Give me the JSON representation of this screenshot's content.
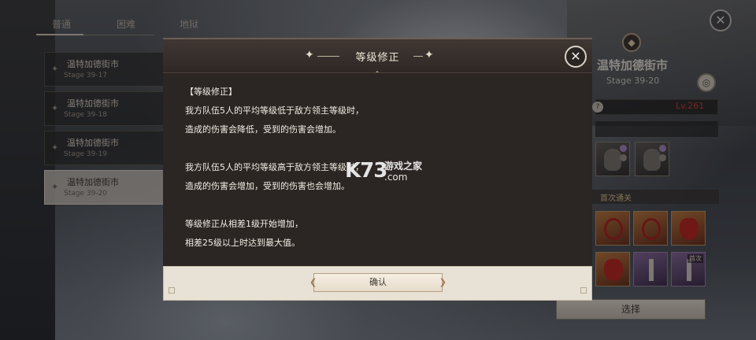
{
  "tabs": [
    "普通",
    "困难",
    "地狱"
  ],
  "stages": [
    {
      "name": "温特加德街市",
      "sub": "Stage 39-17"
    },
    {
      "name": "温特加德街市",
      "sub": "Stage 39-18"
    },
    {
      "name": "温特加德街市",
      "sub": "Stage 39-19"
    },
    {
      "name": "温特加德街市",
      "sub": "Stage 39-20"
    }
  ],
  "right_panel": {
    "title": "温特加德街市",
    "stage": "Stage 39-20",
    "level": "Lv.261",
    "help": "?",
    "first_clear": "首次通关",
    "reward_tag": "首次",
    "select_label": "选择"
  },
  "modal": {
    "title": "等级修正",
    "lines": [
      "【等级修正】",
      "我方队伍5人的平均等级低于敌方领主等级时，",
      "造成的伤害会降低，受到的伤害会增加。",
      "",
      "我方队伍5人的平均等级高于敌方领主等级时，",
      "造成的伤害会增加，受到的伤害也会增加。",
      "",
      "等级修正从相差1级开始增加，",
      "相差25级以上时达到最大值。"
    ],
    "confirm_label": "确认"
  },
  "watermark": {
    "logo": "K73",
    "text": "游戏之家",
    "domain": ".com"
  },
  "icons": {
    "close": "close-icon",
    "pin": "pin-icon",
    "eye": "eye-icon",
    "boss": "boss-icon",
    "sparkle": "sparkle-icon"
  }
}
